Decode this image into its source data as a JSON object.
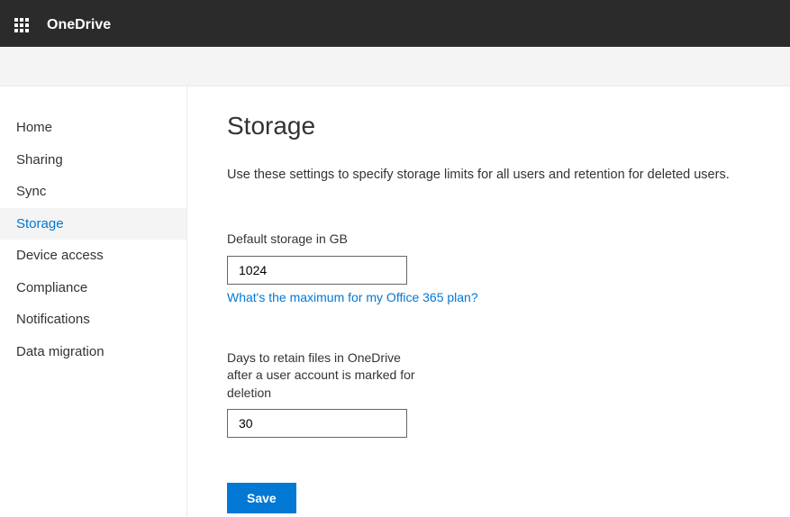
{
  "header": {
    "app_name": "OneDrive"
  },
  "sidebar": {
    "items": [
      {
        "label": "Home",
        "active": false
      },
      {
        "label": "Sharing",
        "active": false
      },
      {
        "label": "Sync",
        "active": false
      },
      {
        "label": "Storage",
        "active": true
      },
      {
        "label": "Device access",
        "active": false
      },
      {
        "label": "Compliance",
        "active": false
      },
      {
        "label": "Notifications",
        "active": false
      },
      {
        "label": "Data migration",
        "active": false
      }
    ]
  },
  "main": {
    "title": "Storage",
    "description": "Use these settings to specify storage limits for all users and retention for deleted users.",
    "default_storage": {
      "label": "Default storage in GB",
      "value": "1024",
      "help_link": "What's the maximum for my Office 365 plan?"
    },
    "retention": {
      "label": "Days to retain files in OneDrive after a user account is marked for deletion",
      "value": "30"
    },
    "save_label": "Save"
  }
}
